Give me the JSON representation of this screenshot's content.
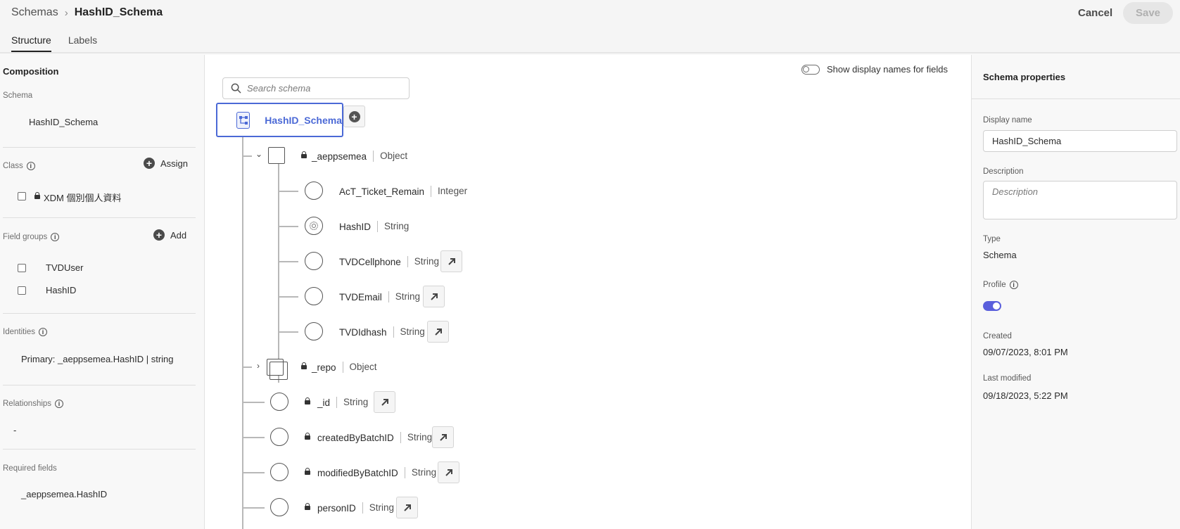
{
  "header": {
    "breadcrumb_root": "Schemas",
    "breadcrumb_current": "HashID_Schema",
    "cancel_label": "Cancel",
    "save_label": "Save",
    "tabs": [
      "Structure",
      "Labels"
    ],
    "active_tab": "Structure"
  },
  "composition": {
    "title": "Composition",
    "schema_label": "Schema",
    "schema_name": "HashID_Schema",
    "class_label": "Class",
    "assign_label": "Assign",
    "class_item": "XDM 個別個人資料",
    "field_groups_label": "Field groups",
    "add_label": "Add",
    "field_groups": [
      "TVDUser",
      "HashID"
    ],
    "identities_label": "Identities",
    "identity_value": "Primary: _aeppsemea.HashID | string",
    "relationships_label": "Relationships",
    "relationships_value": "-",
    "required_fields_label": "Required fields",
    "required_fields_value": "_aeppsemea.HashID"
  },
  "canvas": {
    "search_placeholder": "Search schema",
    "toggle_label": "Show display names for fields",
    "toggle_on": false,
    "root_name": "HashID_Schema",
    "group1": {
      "name": "_aeppsemea",
      "type": "Object",
      "expanded": true,
      "locked": true
    },
    "group1_fields": [
      {
        "name": "AcT_Ticket_Remain",
        "type": "Integer",
        "icon": "circle",
        "link": false
      },
      {
        "name": "HashID",
        "type": "String",
        "icon": "fingerprint-icon",
        "link": false
      },
      {
        "name": "TVDCellphone",
        "type": "String",
        "icon": "circle",
        "link": true
      },
      {
        "name": "TVDEmail",
        "type": "String",
        "icon": "circle",
        "link": true
      },
      {
        "name": "TVDIdhash",
        "type": "String",
        "icon": "circle",
        "link": true
      }
    ],
    "group2": {
      "name": "_repo",
      "type": "Object",
      "expanded": false,
      "locked": true
    },
    "root_fields": [
      {
        "name": "_id",
        "type": "String",
        "locked": true,
        "link": true
      },
      {
        "name": "createdByBatchID",
        "type": "String",
        "locked": true,
        "link": true
      },
      {
        "name": "modifiedByBatchID",
        "type": "String",
        "locked": true,
        "link": true
      },
      {
        "name": "personID",
        "type": "String",
        "locked": true,
        "link": true
      }
    ]
  },
  "properties": {
    "title": "Schema properties",
    "display_name_label": "Display name",
    "display_name_value": "HashID_Schema",
    "description_label": "Description",
    "description_placeholder": "Description",
    "type_label": "Type",
    "type_value": "Schema",
    "profile_label": "Profile",
    "profile_enabled": true,
    "created_label": "Created",
    "created_value": "09/07/2023, 8:01 PM",
    "last_modified_label": "Last modified",
    "last_modified_value": "09/18/2023, 5:22 PM"
  },
  "colors": {
    "accent": "#4b69d6",
    "toggle_on": "#5a5fdc"
  }
}
